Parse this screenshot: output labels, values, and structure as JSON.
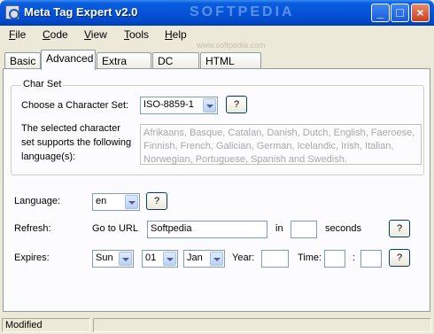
{
  "window": {
    "title": "Meta Tag Expert v2.0",
    "watermark": "SOFTPEDIA",
    "watermark_url": "www.softpedia.com"
  },
  "menu": [
    "File",
    "Code",
    "View",
    "Tools",
    "Help"
  ],
  "tabs": [
    "Basic",
    "Advanced",
    "Extra Tags",
    "DC Tags",
    "HTML Code"
  ],
  "active_tab": "Advanced",
  "charset": {
    "group_title": "Char Set",
    "label": "Choose a Character Set:",
    "value": "ISO-8859-1",
    "help": "?",
    "description": "The selected character set supports the following language(s):",
    "languages": "Afrikaans, Basque, Catalan, Danish, Dutch, English, Faeroese, Finnish, French, Galician, German, Icelandic, Irish, Italian, Norwegian, Portuguese, Spanish and Swedish."
  },
  "language": {
    "label": "Language:",
    "value": "en",
    "help": "?"
  },
  "refresh": {
    "label": "Refresh:",
    "goto_label": "Go to URL",
    "url_value": "Softpedia",
    "in_label": "in",
    "seconds_value": "",
    "seconds_label": "seconds",
    "help": "?"
  },
  "expires": {
    "label": "Expires:",
    "day_value": "Sun",
    "date_value": "01",
    "month_value": "Jan",
    "year_label": "Year:",
    "year_value": "",
    "time_label": "Time:",
    "hour_value": "",
    "separator": ":",
    "minute_value": "",
    "help": "?"
  },
  "status": {
    "text": "Modified"
  }
}
